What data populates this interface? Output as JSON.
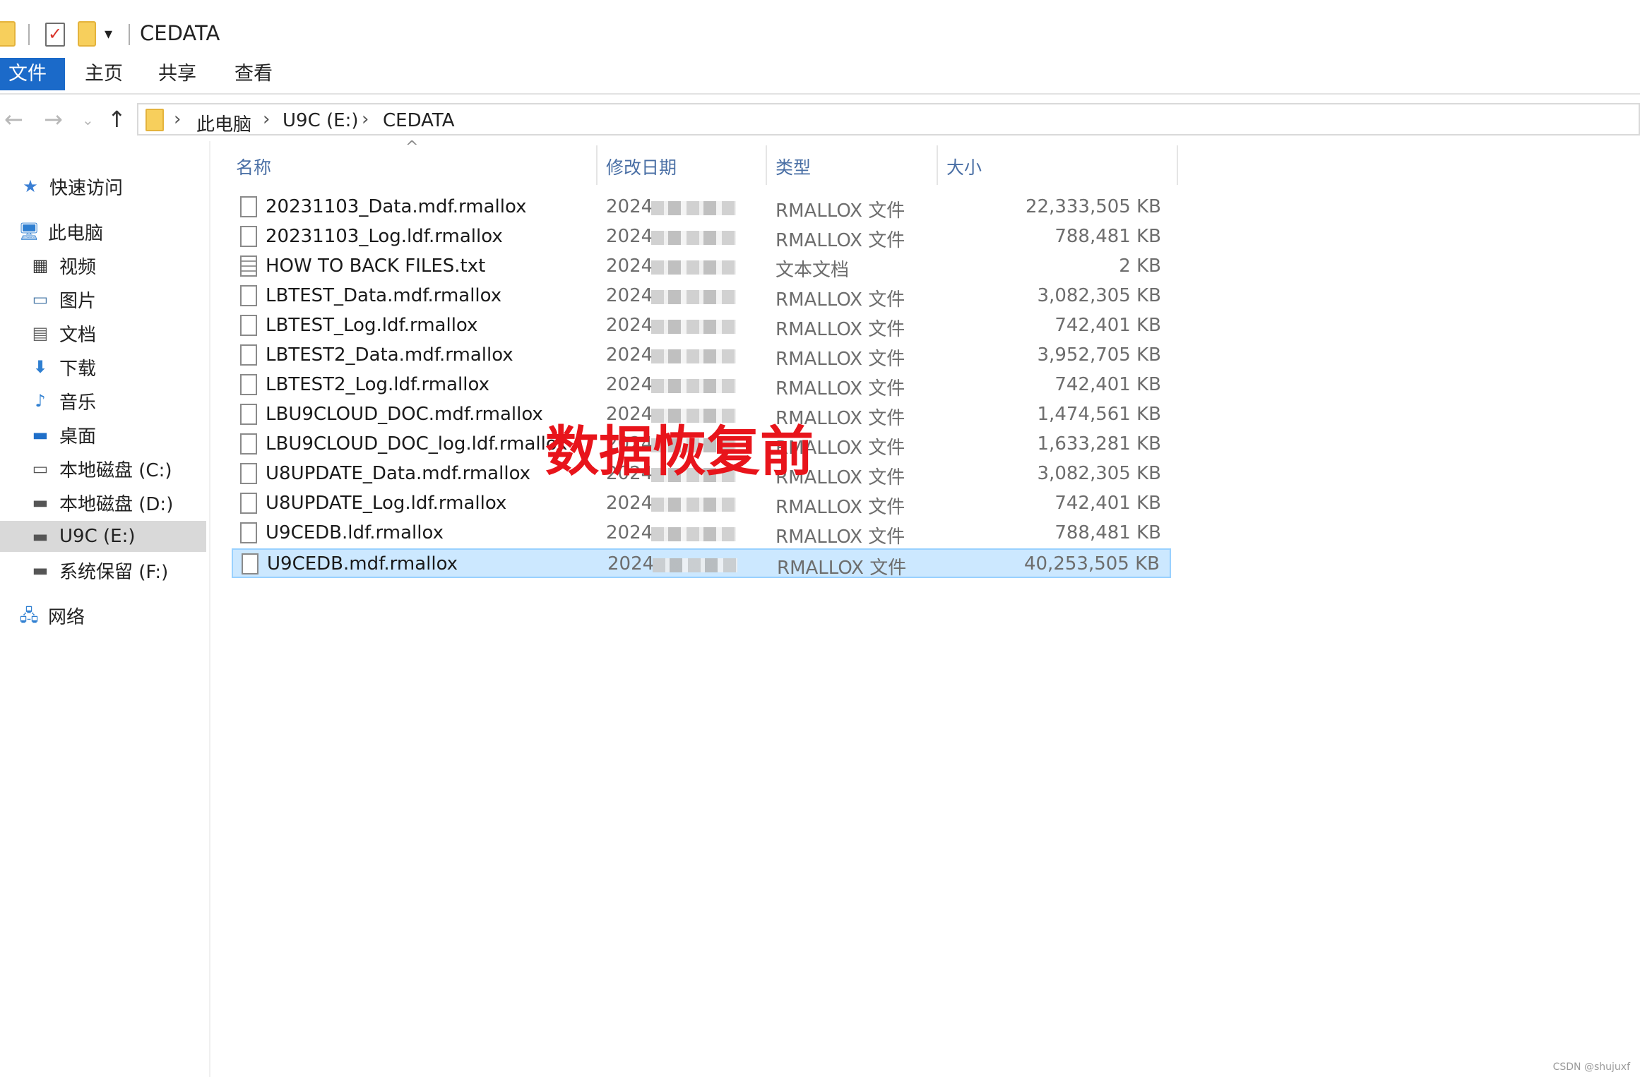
{
  "window": {
    "title": "CEDATA"
  },
  "ribbon": {
    "tabs": [
      "文件",
      "主页",
      "共享",
      "查看"
    ]
  },
  "address": {
    "crumbs": [
      "此电脑",
      "U9C (E:)",
      "CEDATA"
    ]
  },
  "sidebar": {
    "items": [
      {
        "label": "快速访问",
        "icon": "star-icon"
      },
      {
        "label": "此电脑",
        "icon": "computer-icon"
      },
      {
        "label": "视频",
        "icon": "video-icon"
      },
      {
        "label": "图片",
        "icon": "pictures-icon"
      },
      {
        "label": "文档",
        "icon": "documents-icon"
      },
      {
        "label": "下载",
        "icon": "download-icon"
      },
      {
        "label": "音乐",
        "icon": "music-icon"
      },
      {
        "label": "桌面",
        "icon": "desktop-icon"
      },
      {
        "label": "本地磁盘 (C:)",
        "icon": "drive-icon"
      },
      {
        "label": "本地磁盘 (D:)",
        "icon": "drive-icon"
      },
      {
        "label": "U9C (E:)",
        "icon": "drive-icon",
        "selected": true
      },
      {
        "label": "系统保留 (F:)",
        "icon": "drive-icon"
      },
      {
        "label": "网络",
        "icon": "network-icon"
      }
    ]
  },
  "columns": {
    "name": "名称",
    "date": "修改日期",
    "type": "类型",
    "size": "大小"
  },
  "files": [
    {
      "name": "20231103_Data.mdf.rmallox",
      "date": "2024",
      "type": "RMALLOX 文件",
      "size": "22,333,505 KB"
    },
    {
      "name": "20231103_Log.ldf.rmallox",
      "date": "2024",
      "type": "RMALLOX 文件",
      "size": "788,481 KB"
    },
    {
      "name": "HOW TO BACK FILES.txt",
      "date": "2024",
      "type": "文本文档",
      "size": "2 KB"
    },
    {
      "name": "LBTEST_Data.mdf.rmallox",
      "date": "2024",
      "type": "RMALLOX 文件",
      "size": "3,082,305 KB"
    },
    {
      "name": "LBTEST_Log.ldf.rmallox",
      "date": "2024",
      "type": "RMALLOX 文件",
      "size": "742,401 KB"
    },
    {
      "name": "LBTEST2_Data.mdf.rmallox",
      "date": "2024",
      "type": "RMALLOX 文件",
      "size": "3,952,705 KB"
    },
    {
      "name": "LBTEST2_Log.ldf.rmallox",
      "date": "2024",
      "type": "RMALLOX 文件",
      "size": "742,401 KB"
    },
    {
      "name": "LBU9CLOUD_DOC.mdf.rmallox",
      "date": "2024",
      "type": "RMALLOX 文件",
      "size": "1,474,561 KB"
    },
    {
      "name": "LBU9CLOUD_DOC_log.ldf.rmallox",
      "date": "2024",
      "type": "RMALLOX 文件",
      "size": "1,633,281 KB"
    },
    {
      "name": "U8UPDATE_Data.mdf.rmallox",
      "date": "2024",
      "type": "RMALLOX 文件",
      "size": "3,082,305 KB"
    },
    {
      "name": "U8UPDATE_Log.ldf.rmallox",
      "date": "2024",
      "type": "RMALLOX 文件",
      "size": "742,401 KB"
    },
    {
      "name": "U9CEDB.ldf.rmallox",
      "date": "2024",
      "type": "RMALLOX 文件",
      "size": "788,481 KB"
    },
    {
      "name": "U9CEDB.mdf.rmallox",
      "date": "2024",
      "type": "RMALLOX 文件",
      "size": "40,253,505 KB",
      "selected": true
    }
  ],
  "overlay_text": "数据恢复前",
  "watermark": "CSDN @shujuxf",
  "colors": {
    "accent": "#1b6ac9",
    "selection": "#cce8ff",
    "overlay": "#e8141b"
  }
}
